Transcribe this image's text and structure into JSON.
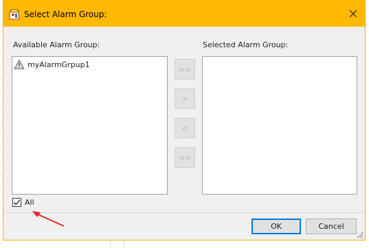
{
  "dialog": {
    "title": "Select Alarm Group:",
    "available_label": "Available Alarm Group:",
    "selected_label": "Selected Alarm Group:",
    "available_items": [
      {
        "label": "myAlarmGrpup1",
        "icon": "alarm-group-icon"
      }
    ],
    "selected_items": [],
    "move_buttons": {
      "add_all": ">>",
      "add": ">",
      "remove": "<",
      "remove_all": "<<"
    },
    "all_checkbox": {
      "label": "All",
      "checked": true
    },
    "ok_label": "OK",
    "cancel_label": "Cancel"
  },
  "colors": {
    "titlebar": "#ffb900",
    "dialog_bg": "#f0f0f0",
    "focus_border": "#0078d7",
    "annotation_arrow": "#e0282e"
  }
}
